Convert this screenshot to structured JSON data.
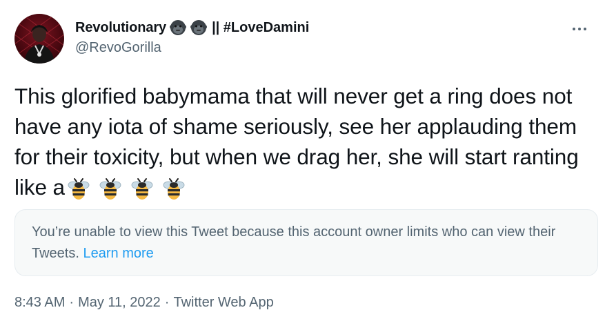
{
  "author": {
    "display_name": "Revolutionary",
    "name_suffix": "|| #LoveDamini",
    "handle": "@RevoGorilla",
    "name_emojis": [
      "gorilla-icon",
      "gorilla-icon"
    ]
  },
  "tweet": {
    "text": "This glorified babymama that will never get a ring does not have any iota of shame seriously, see her applauding them for their toxicity, but when we drag her, she will start ranting like a",
    "trailing_emojis": [
      "bee-icon",
      "bee-icon",
      "bee-icon",
      "bee-icon"
    ]
  },
  "quoted_notice": {
    "text": "You’re unable to view this Tweet because this account owner limits who can view their Tweets.",
    "link_label": "Learn more"
  },
  "meta": {
    "time": "8:43 AM",
    "separator": "·",
    "date": "May 11, 2022",
    "source": "Twitter Web App"
  },
  "colors": {
    "text": "#0f1419",
    "secondary": "#536471",
    "link": "#1d9bf0",
    "notice_bg": "#f7f9f9"
  }
}
